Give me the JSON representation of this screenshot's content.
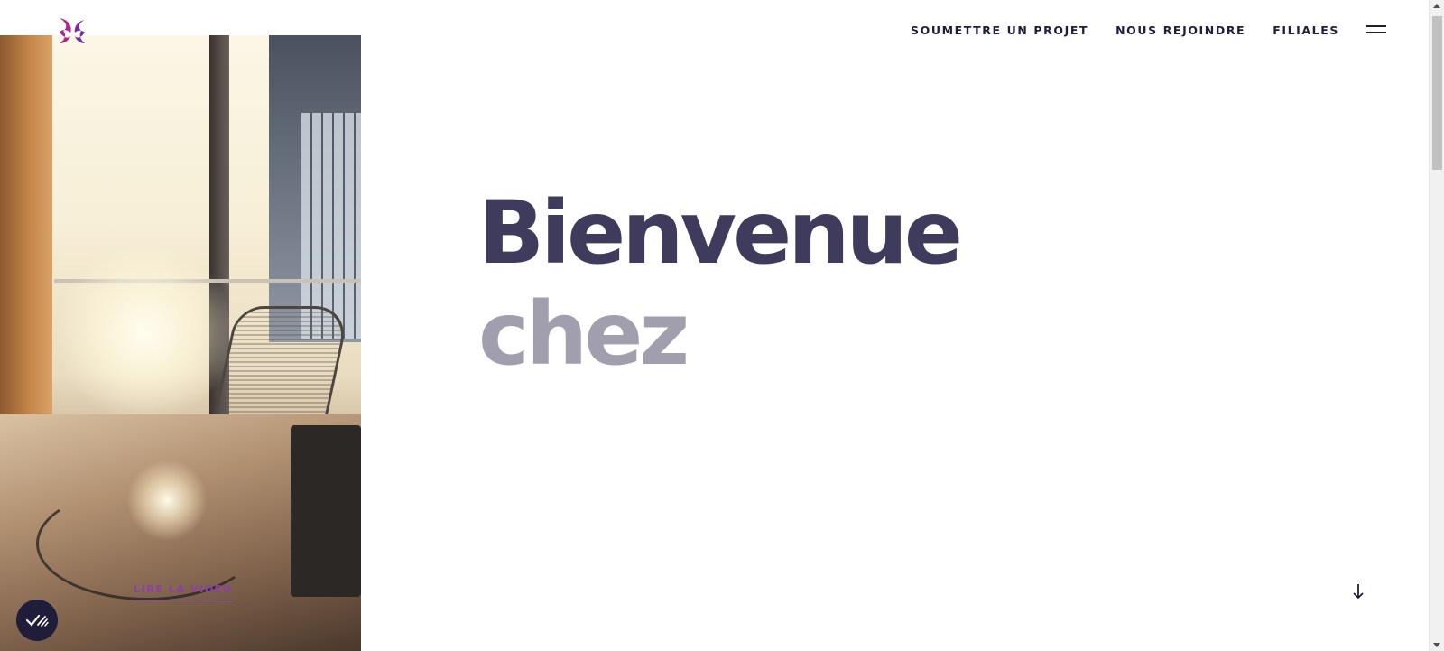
{
  "header": {
    "logo_icon": "butterfly-logo-icon",
    "nav": [
      {
        "label": "SOUMETTRE UN PROJET"
      },
      {
        "label": "NOUS REJOINDRE"
      },
      {
        "label": "FILIALES"
      }
    ],
    "menu_icon": "hamburger-menu-icon"
  },
  "hero": {
    "title_line1": "Bienvenue",
    "title_line2": "chez",
    "image_description_icon": "office-photo",
    "video_link": "LIRE LA VIDÉO",
    "scroll_icon": "arrow-down-icon"
  },
  "floating": {
    "icon": "cookie-consent-icon"
  },
  "colors": {
    "brand_navy": "#1f1d3a",
    "title_dark": "#3f3b5c",
    "title_light": "#a19fae",
    "accent_purple": "#8b3fa8",
    "logo_magenta": "#b0268a"
  }
}
